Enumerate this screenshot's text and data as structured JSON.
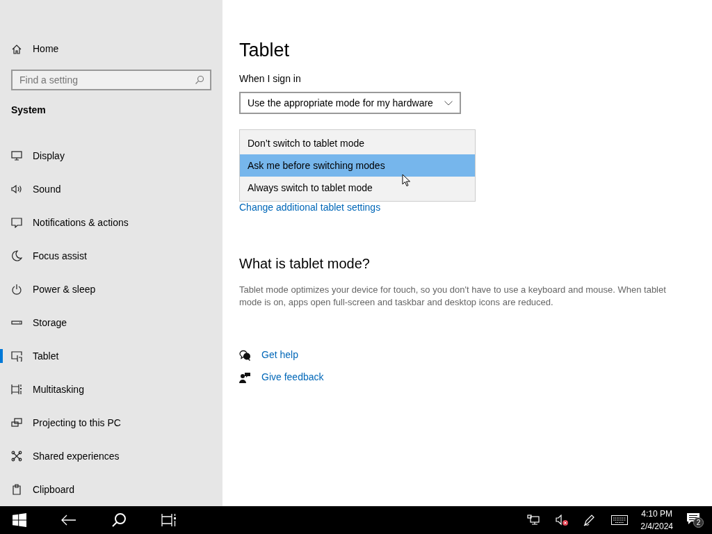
{
  "sidebar": {
    "home": "Home",
    "search": {
      "placeholder": "Find a setting"
    },
    "section": "System",
    "items": [
      {
        "label": "Display",
        "selected": false
      },
      {
        "label": "Sound",
        "selected": false
      },
      {
        "label": "Notifications & actions",
        "selected": false
      },
      {
        "label": "Focus assist",
        "selected": false
      },
      {
        "label": "Power & sleep",
        "selected": false
      },
      {
        "label": "Storage",
        "selected": false
      },
      {
        "label": "Tablet",
        "selected": true
      },
      {
        "label": "Multitasking",
        "selected": false
      },
      {
        "label": "Projecting to this PC",
        "selected": false
      },
      {
        "label": "Shared experiences",
        "selected": false
      },
      {
        "label": "Clipboard",
        "selected": false
      }
    ]
  },
  "content": {
    "title": "Tablet",
    "sign_in_label": "When I sign in",
    "sign_in_value": "Use the appropriate mode for my hardware",
    "dropdown_options": [
      {
        "label": "Don’t switch to tablet mode",
        "selected": false
      },
      {
        "label": "Ask me before switching modes",
        "selected": true
      },
      {
        "label": "Always switch to tablet mode",
        "selected": false
      }
    ],
    "link": "Change additional tablet settings",
    "section_title": "What is tablet mode?",
    "description": "Tablet mode optimizes your device for touch, so you don't have to use a keyboard and mouse. When tablet mode is on, apps open full-screen and taskbar and desktop icons are reduced.",
    "help_links": [
      "Get help",
      "Give feedback"
    ]
  },
  "taskbar": {
    "time": "4:10 PM",
    "date": "2/4/2024",
    "notification_count": "2"
  }
}
